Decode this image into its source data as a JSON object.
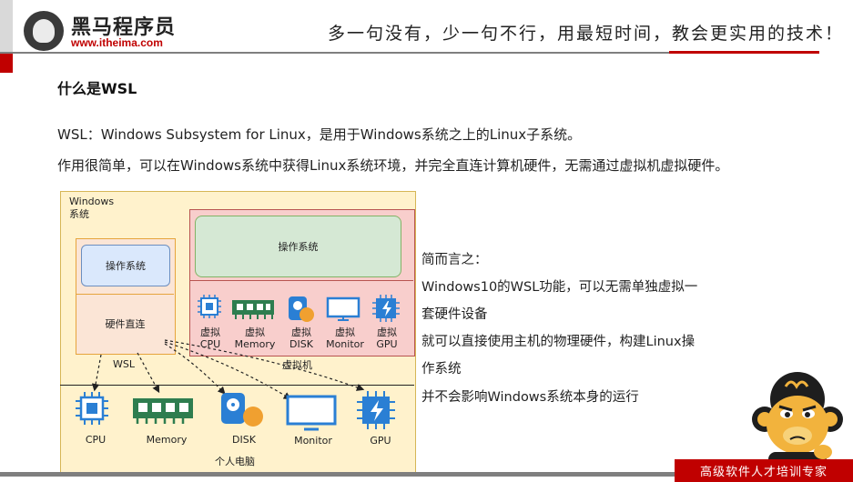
{
  "header": {
    "logo_text": "黑马程序员",
    "logo_url": "www.itheima.com",
    "slogan": "多一句没有，少一句不行，用最短时间，教会更实用的技术！",
    "accent_color": "#c00000"
  },
  "title": "什么是WSL",
  "paragraphs": [
    "WSL：Windows Subsystem for Linux，是用于Windows系统之上的Linux子系统。",
    "作用很简单，可以在Windows系统中获得Linux系统环境，并完全直连计算机硬件，无需通过虚拟机虚拟硬件。"
  ],
  "diagram": {
    "windows_label_1": "Windows",
    "windows_label_2": "系统",
    "wsl_os": "操作系统",
    "wsl_hw": "硬件直连",
    "wsl_label": "WSL",
    "vm_os": "操作系统",
    "vm_label": "虚拟机",
    "pc_label": "个人电脑",
    "virtual_hw": [
      {
        "l1": "虚拟",
        "l2": "CPU",
        "icon": "cpu-icon"
      },
      {
        "l1": "虚拟",
        "l2": "Memory",
        "icon": "memory-icon"
      },
      {
        "l1": "虚拟",
        "l2": "DISK",
        "icon": "disk-icon"
      },
      {
        "l1": "虚拟",
        "l2": "Monitor",
        "icon": "monitor-icon"
      },
      {
        "l1": "虚拟",
        "l2": "GPU",
        "icon": "gpu-icon"
      }
    ],
    "physical_hw": [
      "CPU",
      "Memory",
      "DISK",
      "Monitor",
      "GPU"
    ]
  },
  "notes": [
    "简而言之：",
    "Windows10的WSL功能，可以无需单独虚拟一",
    "套硬件设备",
    "就可以直接使用主机的物理硬件，构建Linux操",
    "作系统",
    "并不会影响Windows系统本身的运行"
  ],
  "footer": {
    "tagline": "高级软件人才培训专家"
  }
}
